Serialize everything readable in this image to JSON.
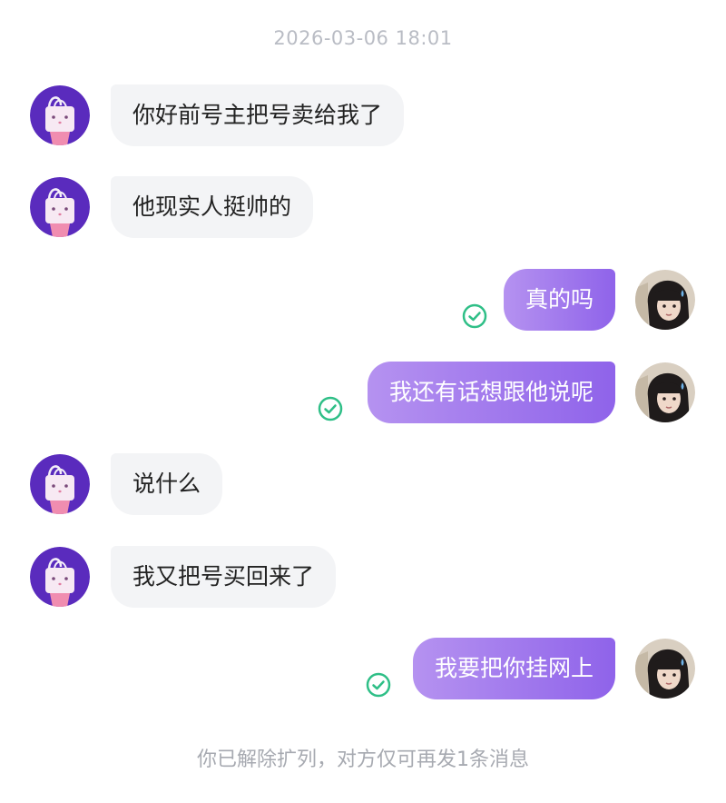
{
  "chat": {
    "timestamp": "2026-03-06 18:01",
    "messages": [
      {
        "side": "in",
        "text": "你好前号主把号卖给我了"
      },
      {
        "side": "in",
        "text": "他现实人挺帅的"
      },
      {
        "side": "out",
        "text": "真的吗",
        "status": "read-check-icon"
      },
      {
        "side": "out",
        "text": "我还有话想跟他说呢",
        "status": "read-check-icon"
      },
      {
        "side": "in",
        "text": "说什么"
      },
      {
        "side": "in",
        "text": "我又把号买回来了"
      },
      {
        "side": "out",
        "text": "我要把你挂网上",
        "status": "read-check-icon"
      }
    ],
    "footer_notice": "你已解除扩列，对方仅可再发1条消息"
  },
  "colors": {
    "incoming_bubble": "#f3f4f6",
    "outgoing_gradient_start": "#b592f0",
    "outgoing_gradient_end": "#8f63ea",
    "read_check": "#2fbf87",
    "left_avatar_bg": "#5a2bbd"
  }
}
